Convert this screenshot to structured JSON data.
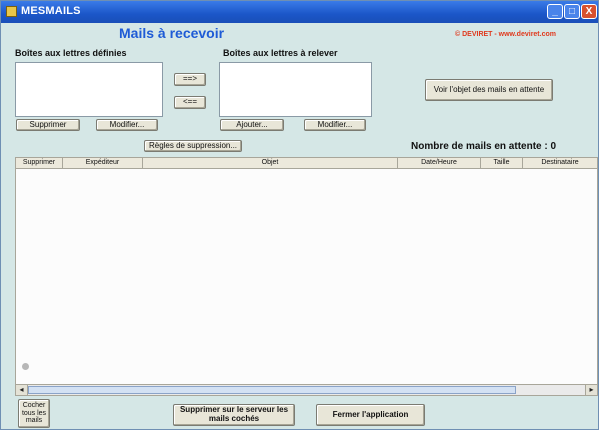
{
  "window": {
    "title": "MESMAILS",
    "minimize": "_",
    "maximize": "□",
    "close": "X"
  },
  "header": {
    "title": "Mails à recevoir",
    "credit": "© DEVIRET - www.deviret.com"
  },
  "left_panel": {
    "label": "Boîtes aux lettres définies",
    "delete_button": "Supprimer",
    "modify_button": "Modifier..."
  },
  "arrows": {
    "add": "==>",
    "remove": "<=="
  },
  "right_panel": {
    "label": "Boîtes aux lettres à relever",
    "add_button": "Ajouter...",
    "modify_button": "Modifier..."
  },
  "subject_button": "Voir l'objet des mails en attente",
  "rules_button": "Règles de suppression...",
  "pending": {
    "label": "Nombre de mails en attente : 0"
  },
  "table": {
    "columns": [
      "Supprimer",
      "Expéditeur",
      "Objet",
      "Date/Heure",
      "Taille",
      "Destinataire"
    ],
    "rows": []
  },
  "scrollbar": {
    "left_arrow": "◂",
    "right_arrow": "▸"
  },
  "footer": {
    "check_all": "Cocher tous les mails",
    "delete_server": "Supprimer sur le serveur les mails cochés",
    "close_app": "Fermer l'application"
  }
}
